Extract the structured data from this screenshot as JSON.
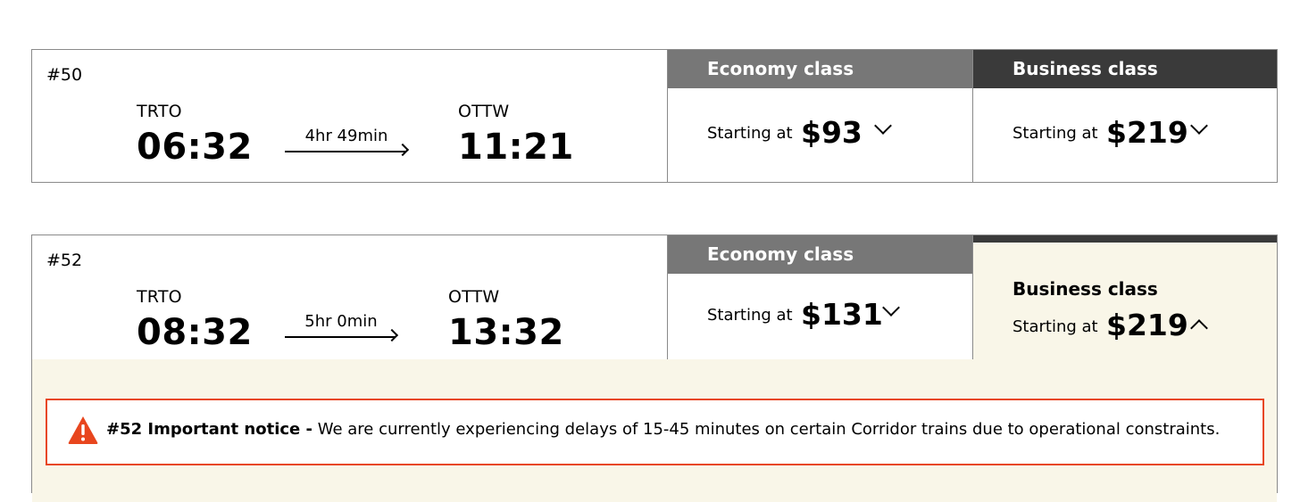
{
  "trips": [
    {
      "number": "#50",
      "origin": "TRTO",
      "depart": "06:32",
      "duration": "4hr 49min",
      "destination": "OTTW",
      "arrive": "11:21",
      "economy": {
        "title": "Economy class",
        "label": "Starting at",
        "price": "$93"
      },
      "business": {
        "title": "Business class",
        "label": "Starting at",
        "price": "$219"
      }
    },
    {
      "number": "#52",
      "origin": "TRTO",
      "depart": "08:32",
      "duration": "5hr 0min",
      "destination": "OTTW",
      "arrive": "13:32",
      "economy": {
        "title": "Economy class",
        "label": "Starting at",
        "price": "$131"
      },
      "business": {
        "title": "Business class",
        "label": "Starting at",
        "price": "$219"
      },
      "notice": {
        "title": "#52 Important notice -",
        "text": "We are currently experiencing delays of 15-45 minutes on certain Corridor trains due to operational constraints."
      }
    }
  ],
  "colors": {
    "economy_header": "#777777",
    "business_header": "#3a3a3a",
    "selected_bg": "#f9f6e8",
    "notice_border": "#e8461e"
  },
  "icons": {
    "collapsed": "chevron-down-icon",
    "expanded": "chevron-up-icon",
    "notice": "warning-icon"
  }
}
